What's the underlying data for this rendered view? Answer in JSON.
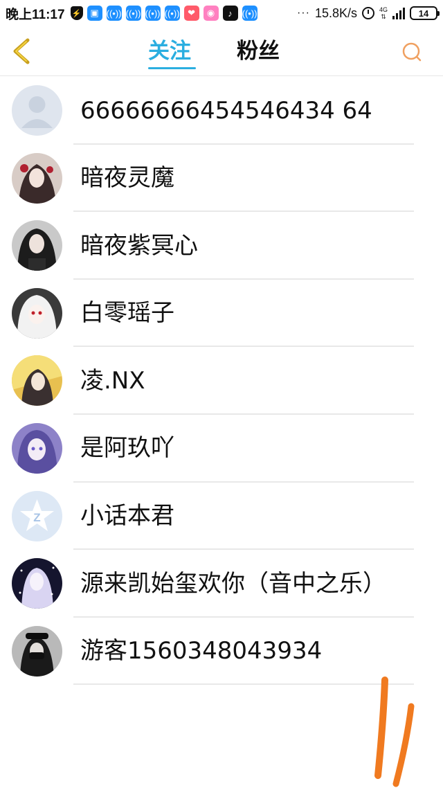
{
  "status_bar": {
    "time": "晚上11:17",
    "speed": "15.8K/s",
    "dots": "···",
    "network": "4G",
    "battery": "14",
    "icons": [
      "shield-icon",
      "app-icon",
      "wifi-hotspot-icon",
      "wifi-hotspot-icon",
      "wifi-hotspot-icon",
      "wifi-hotspot-icon",
      "app-icon",
      "camera-app-icon",
      "tiktok-icon",
      "wifi-hotspot-icon"
    ]
  },
  "header": {
    "tabs": [
      {
        "label": "关注",
        "active": true
      },
      {
        "label": "粉丝",
        "active": false
      }
    ],
    "accent_color": "#2aaee0",
    "back_icon": "chevron-left-icon",
    "search_icon": "search-icon"
  },
  "list": [
    {
      "name": "66666666454546434 64",
      "avatar": "default-person-avatar"
    },
    {
      "name": "暗夜灵魔",
      "avatar": "anime-girl-red-avatar"
    },
    {
      "name": "暗夜紫冥心",
      "avatar": "anime-girl-dark-avatar"
    },
    {
      "name": "白零瑶子",
      "avatar": "anime-girl-white-avatar"
    },
    {
      "name": "凌.NX",
      "avatar": "anime-character-yellow-avatar"
    },
    {
      "name": "是阿玖吖",
      "avatar": "anime-girl-purple-avatar"
    },
    {
      "name": "小话本君",
      "avatar": "qzone-logo-avatar"
    },
    {
      "name": "源来凯始玺欢你（音中之乐）",
      "avatar": "anime-girl-sparkle-avatar"
    },
    {
      "name": "游客1560348043934",
      "avatar": "masked-person-avatar"
    }
  ]
}
